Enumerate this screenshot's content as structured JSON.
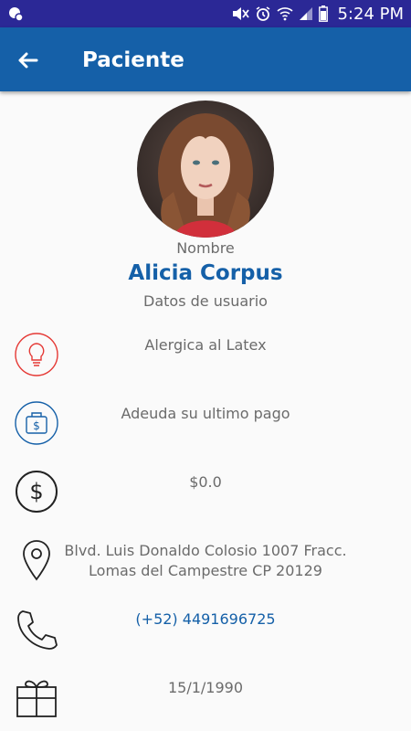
{
  "status_bar": {
    "time": "5:24 PM",
    "icons": [
      "notification-icon",
      "mute-icon",
      "alarm-icon",
      "wifi-icon",
      "signal-icon",
      "battery-icon"
    ]
  },
  "app_bar": {
    "title": "Paciente",
    "back_icon": "arrow-back-icon"
  },
  "profile": {
    "name_label": "Nombre",
    "name": "Alicia Corpus",
    "subtitle": "Datos de usuario"
  },
  "details": {
    "allergy": "Alergica al Latex",
    "payment_status": "Adeuda su ultimo pago",
    "balance": "$0.0",
    "address_line1": "Blvd. Luis Donaldo Colosio 1007 Fracc.",
    "address_line2": "Lomas del Campestre CP 20129",
    "phone": "(+52) 4491696725",
    "birthday": "15/1/1990"
  },
  "colors": {
    "status_bar": "#2b2896",
    "app_bar": "#1560a8",
    "accent_blue": "#1560a8",
    "allergy_red": "#e53935",
    "text_gray": "#6b6b6b"
  }
}
